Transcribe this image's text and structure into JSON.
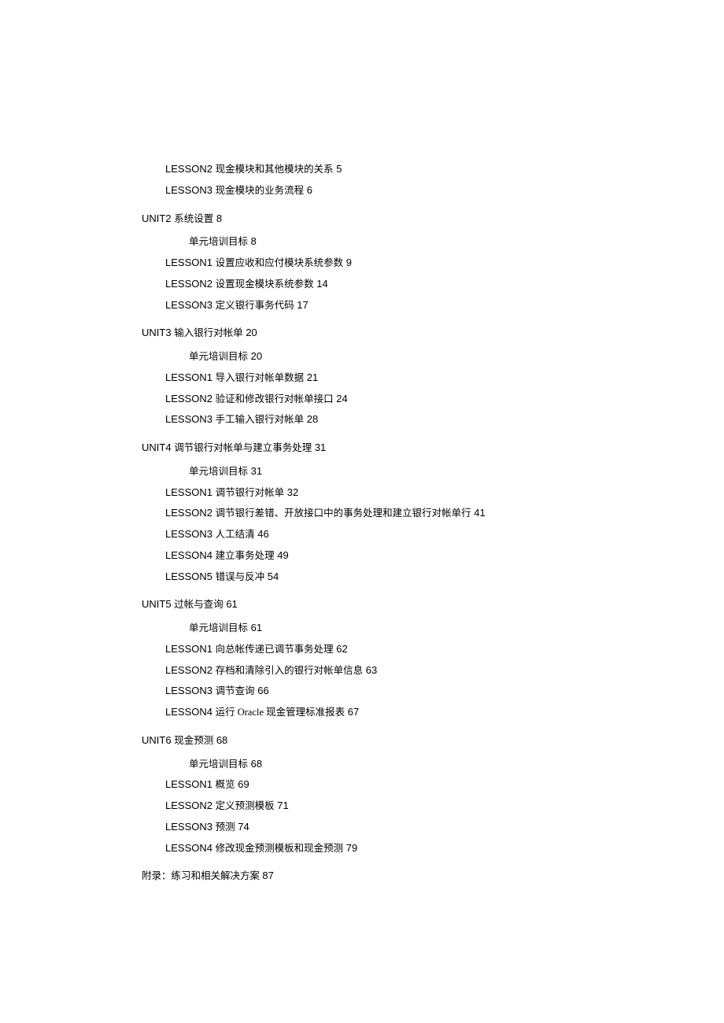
{
  "preUnitLessons": [
    {
      "label": "LESSON2",
      "title": "现金模块和其他模块的关系",
      "page": "5"
    },
    {
      "label": "LESSON3",
      "title": "现金模块的业务流程",
      "page": "6"
    }
  ],
  "units": [
    {
      "label": "UNIT2",
      "title": "系统设置",
      "page": "8",
      "goal": {
        "title": "单元培训目标",
        "page": "8"
      },
      "lessons": [
        {
          "label": "LESSON1",
          "title": "设置应收和应付模块系统参数",
          "page": "9"
        },
        {
          "label": "LESSON2",
          "title": "设置现金模块系统参数",
          "page": "14"
        },
        {
          "label": "LESSON3",
          "title": "定义银行事务代码",
          "page": "17"
        }
      ]
    },
    {
      "label": "UNIT3",
      "title": "输入银行对帐单",
      "page": "20",
      "goal": {
        "title": "单元培训目标",
        "page": "20"
      },
      "lessons": [
        {
          "label": "LESSON1",
          "title": "导入银行对帐单数据",
          "page": "21"
        },
        {
          "label": "LESSON2",
          "title": "验证和修改银行对帐单接口",
          "page": "24"
        },
        {
          "label": "LESSON3",
          "title": "手工输入银行对帐单",
          "page": "28"
        }
      ]
    },
    {
      "label": "UNIT4",
      "title": "调节银行对帐单与建立事务处理",
      "page": "31",
      "goal": {
        "title": "单元培训目标",
        "page": "31"
      },
      "lessons": [
        {
          "label": "LESSON1",
          "title": "调节银行对帐单",
          "page": "32"
        },
        {
          "label": "LESSON2",
          "title": "调节银行差错、开放接口中的事务处理和建立银行对帐单行",
          "page": "41"
        },
        {
          "label": "LESSON3",
          "title": "人工结清",
          "page": "46"
        },
        {
          "label": "LESSON4",
          "title": "建立事务处理",
          "page": "49"
        },
        {
          "label": "LESSON5",
          "title": "错误与反冲",
          "page": "54"
        }
      ]
    },
    {
      "label": "UNIT5",
      "title": "过帐与查询",
      "page": "61",
      "goal": {
        "title": "单元培训目标",
        "page": "61"
      },
      "lessons": [
        {
          "label": "LESSON1",
          "title": "向总帐传递已调节事务处理",
          "page": "62"
        },
        {
          "label": "LESSON2",
          "title": "存档和清除引入的银行对帐单信息",
          "page": "63"
        },
        {
          "label": "LESSON3",
          "title": "调节查询",
          "page": "66"
        },
        {
          "label": "LESSON4",
          "title": "运行 Oracle 现金管理标准报表",
          "page": "67"
        }
      ]
    },
    {
      "label": "UNIT6",
      "title": "现金预测",
      "page": "68",
      "goal": {
        "title": "单元培训目标",
        "page": "68"
      },
      "lessons": [
        {
          "label": "LESSON1",
          "title": "概览",
          "page": "69"
        },
        {
          "label": "LESSON2",
          "title": "定义预测模板",
          "page": "71"
        },
        {
          "label": "LESSON3",
          "title": "预测",
          "page": "74"
        },
        {
          "label": "LESSON4",
          "title": "修改现金预测模板和现金预测",
          "page": "79"
        }
      ]
    }
  ],
  "appendix": {
    "title": "附录：练习和相关解决方案",
    "page": "87"
  }
}
